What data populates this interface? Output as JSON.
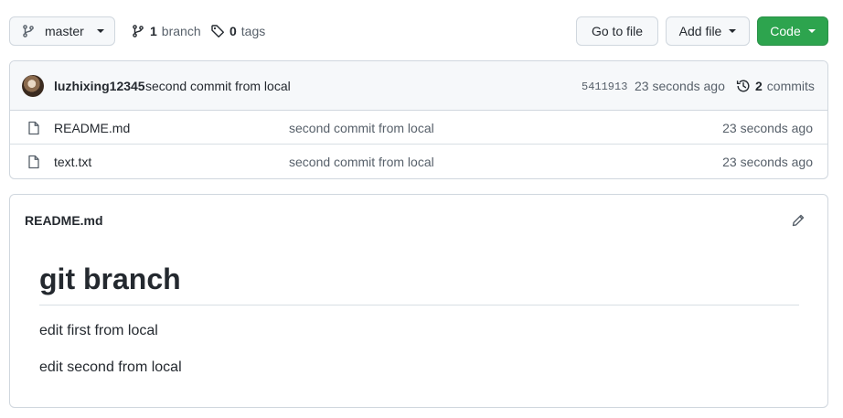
{
  "toolbar": {
    "branch_label": "master",
    "branches_count": "1",
    "branches_label": "branch",
    "tags_count": "0",
    "tags_label": "tags",
    "goto_file_label": "Go to file",
    "add_file_label": "Add file",
    "code_label": "Code"
  },
  "latest_commit": {
    "author": "luzhixing12345",
    "message": "second commit from local",
    "sha": "5411913",
    "time": "23 seconds ago",
    "commits_count": "2",
    "commits_label": "commits"
  },
  "files": [
    {
      "name": "README.md",
      "commit_message": "second commit from local",
      "age": "23 seconds ago"
    },
    {
      "name": "text.txt",
      "commit_message": "second commit from local",
      "age": "23 seconds ago"
    }
  ],
  "readme": {
    "filename": "README.md",
    "heading": "git branch",
    "paragraphs": [
      "edit first from local",
      "edit second from local"
    ]
  },
  "colors": {
    "code_button": "#2da44e",
    "border": "#d0d7de",
    "muted_text": "#57606a"
  },
  "icons": [
    "git-branch-icon",
    "tag-icon",
    "history-icon",
    "file-icon",
    "pencil-icon",
    "caret-down-icon"
  ]
}
